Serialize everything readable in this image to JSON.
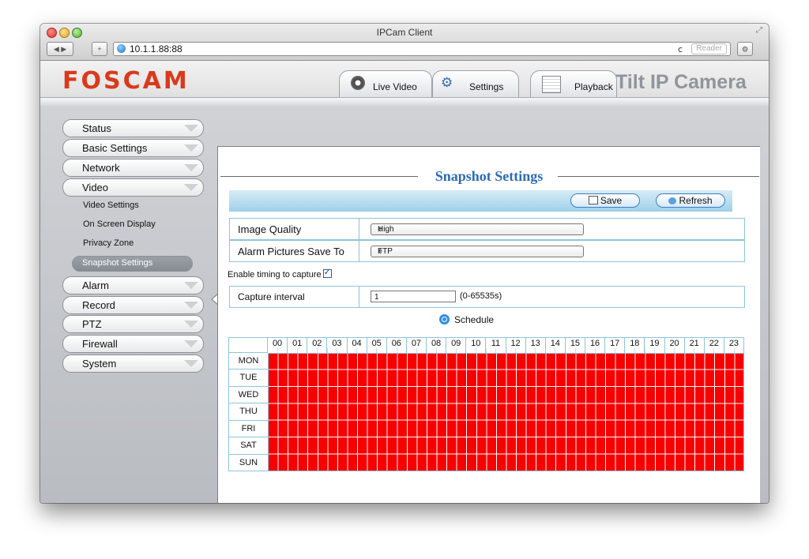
{
  "window": {
    "title": "IPCam Client"
  },
  "browser": {
    "address": "10.1.1.88:88",
    "reader": "Reader"
  },
  "brand": {
    "logo": "FOSCAM",
    "product": "Tilt IP Camera"
  },
  "tabs": [
    {
      "label": "Live Video",
      "icon": "camera-icon"
    },
    {
      "label": "Settings",
      "icon": "gear-icon"
    },
    {
      "label": "Playback",
      "icon": "calendar-icon"
    }
  ],
  "sidebar": {
    "items": [
      {
        "label": "Status"
      },
      {
        "label": "Basic Settings"
      },
      {
        "label": "Network"
      },
      {
        "label": "Video"
      },
      {
        "label": "Alarm"
      },
      {
        "label": "Record"
      },
      {
        "label": "PTZ"
      },
      {
        "label": "Firewall"
      },
      {
        "label": "System"
      }
    ],
    "video_sub": [
      "Video Settings",
      "On Screen Display",
      "Privacy Zone",
      "Snapshot Settings"
    ]
  },
  "main": {
    "title": "Snapshot Settings",
    "save_label": "Save",
    "refresh_label": "Refresh",
    "image_quality_label": "Image Quality",
    "image_quality_value": "High",
    "alarm_save_label": "Alarm Pictures Save To",
    "alarm_save_value": "FTP",
    "enable_timing_label": "Enable timing to capture",
    "enable_timing_checked": true,
    "capture_interval_label": "Capture interval",
    "capture_interval_value": "1",
    "capture_interval_range": "(0-65535s)",
    "schedule_label": "Schedule"
  },
  "schedule": {
    "hours": [
      "00",
      "01",
      "02",
      "03",
      "04",
      "05",
      "06",
      "07",
      "08",
      "09",
      "10",
      "11",
      "12",
      "13",
      "14",
      "15",
      "16",
      "17",
      "18",
      "19",
      "20",
      "21",
      "22",
      "23"
    ],
    "days": [
      "MON",
      "TUE",
      "WED",
      "THU",
      "FRI",
      "SAT",
      "SUN"
    ],
    "selected_color": "#f60000"
  },
  "colors": {
    "accent": "#2d6bb5",
    "logo": "#d93a1c"
  }
}
